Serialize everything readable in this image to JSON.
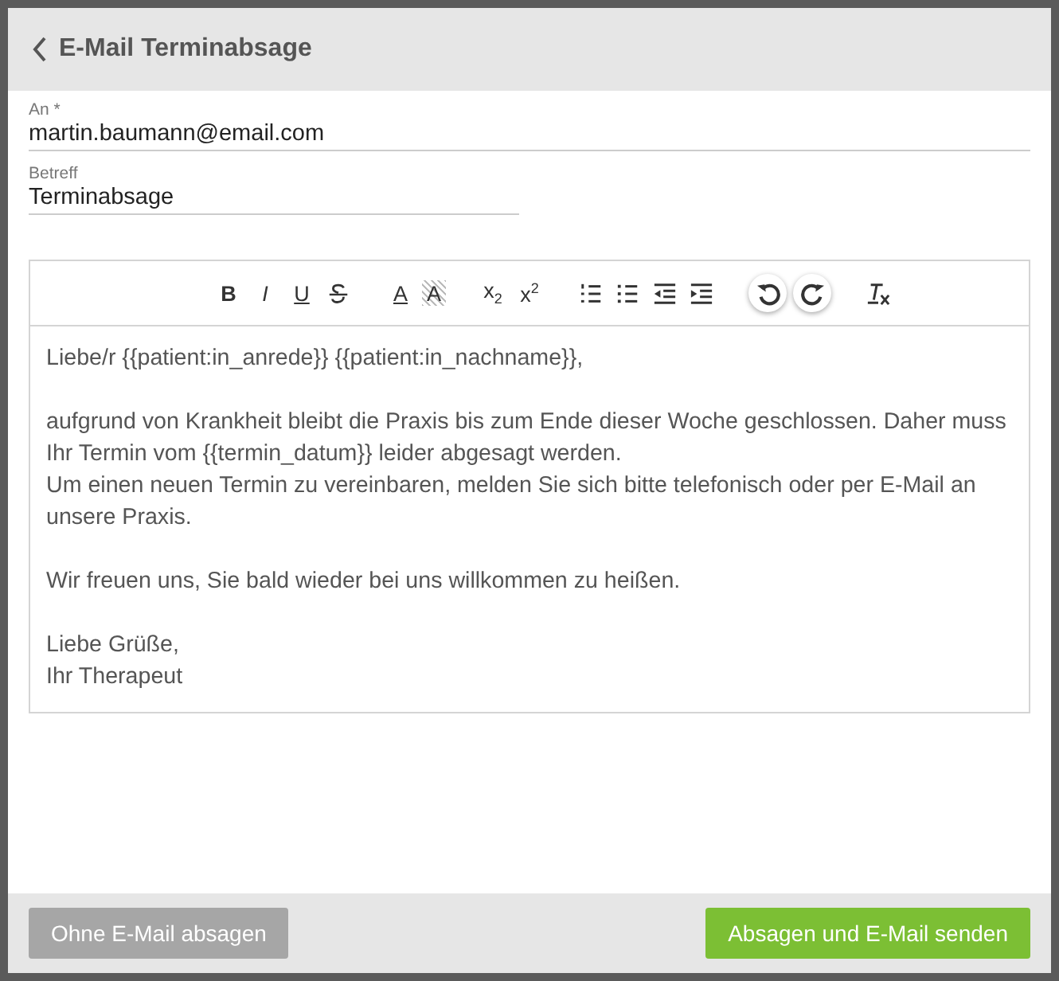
{
  "header": {
    "title": "E-Mail Terminabsage"
  },
  "fields": [
    {
      "label": "An *",
      "value": "martin.baumann@email.com"
    },
    {
      "label": "Betreff",
      "value": "Terminabsage"
    }
  ],
  "toolbar": [
    {
      "kind": "text",
      "label": "B"
    },
    {
      "kind": "text",
      "label": "I"
    },
    {
      "kind": "text",
      "label": "U"
    },
    {
      "kind": "icon"
    },
    {
      "kind": "text",
      "label": "A"
    },
    {
      "kind": "text",
      "label": "A"
    },
    {
      "kind": "text",
      "label": "x$_{2}$"
    },
    {
      "kind": "text",
      "label": "x$^{2}$"
    },
    {
      "kind": "icon"
    },
    {
      "kind": "icon"
    },
    {
      "kind": "icon"
    },
    {
      "kind": "icon"
    },
    {
      "kind": "icon"
    },
    {
      "kind": "icon"
    },
    {
      "kind": "icon"
    }
  ],
  "body": [
    [
      "Liebe/r {{patient:in_anrede}} {{patient:in_nachname}},"
    ],
    [
      "aufgrund von Krankheit bleibt die Praxis bis zum Ende dieser Woche geschlossen. Daher muss Ihr Termin vom {{termin_datum}} leider abgesagt werden.",
      "Um einen neuen Termin zu vereinbaren, melden Sie sich bitte telefonisch oder per E-Mail an unsere Praxis."
    ],
    [
      "Wir freuen uns, Sie bald wieder bei uns willkommen zu heißen."
    ],
    [
      "Liebe Grüße,",
      "Ihr Therapeut"
    ]
  ],
  "buttons": [
    {
      "label": "Ohne E-Mail absagen",
      "kind": "secondary"
    },
    {
      "label": "Absagen und E-Mail senden",
      "kind": "primary"
    }
  ]
}
